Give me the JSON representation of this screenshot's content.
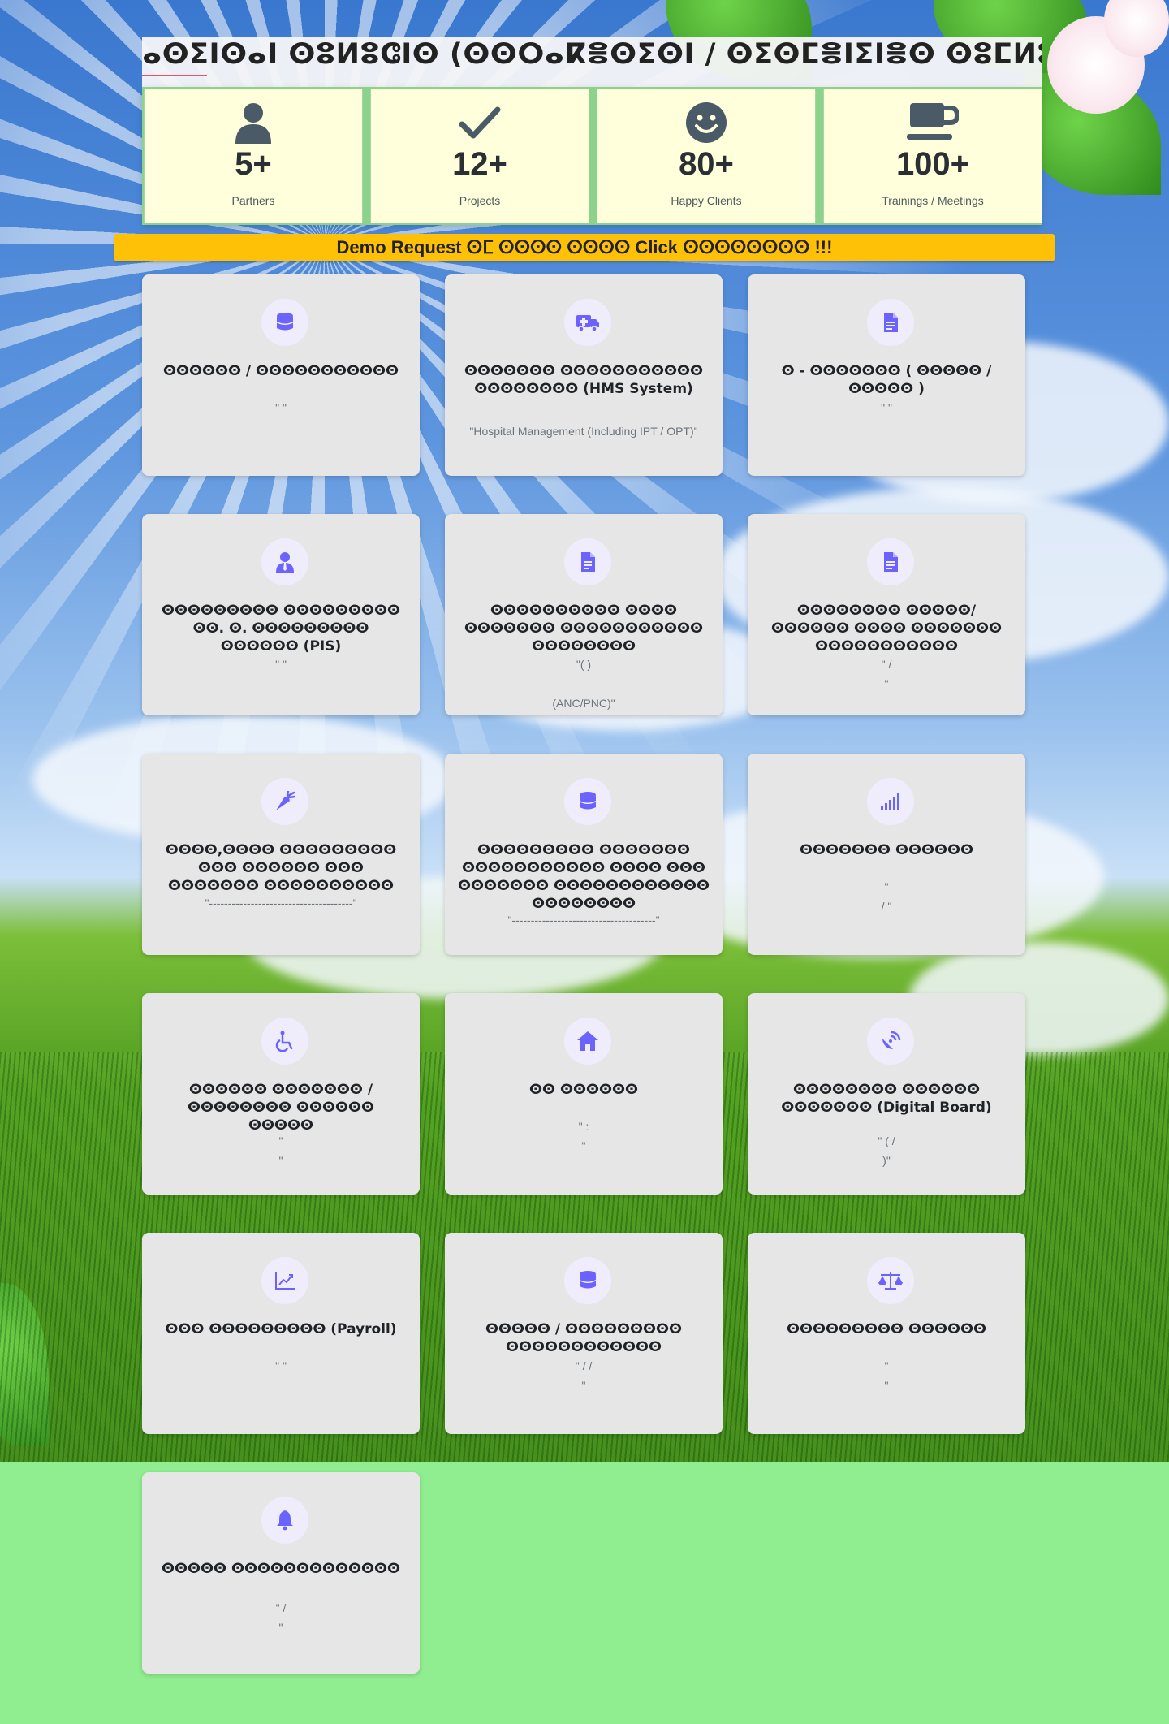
{
  "page": {
    "title": "ⴰⵙⵉⵏⵙⴰⵏ ⵙⵓⵍⵓⵛⵏⵙ (ⵙⵙⵔⴰⴽⴻⵙⵉⵙⵏ / ⵙⵉⵙⵎⴻⵏⵉⵏⴻⵙ ⵙⵓⵎⵍⵓⵙ ⵙⴻⵏⵏⵓⵙⵎⵙⵓⵙⵏ)",
    "demo_request": "Demo Request ⵙⵎ ⵙⵙⵙⵙ ⵙⵙⵙⵙ Click ⵙⵙⵙⵙⵙⵙⵙⵙ !!!"
  },
  "stats": [
    {
      "icon": "user-icon",
      "value": "5+",
      "label": "Partners"
    },
    {
      "icon": "check-icon",
      "value": "12+",
      "label": "Projects"
    },
    {
      "icon": "smile-icon",
      "value": "80+",
      "label": "Happy Clients"
    },
    {
      "icon": "coffee-cup-icon",
      "value": "100+",
      "label": "Trainings / Meetings"
    }
  ],
  "services": [
    {
      "icon": "database-icon",
      "title": "ⵙⵙⵙⵙⵙⵙ / ⵙⵙⵙⵙⵙⵙⵙⵙⵙⵙⵙ",
      "desc": [
        "\"                                                                      \""
      ]
    },
    {
      "icon": "ambulance-icon",
      "title": "ⵙⵙⵙⵙⵙⵙⵙ ⵙⵙⵙⵙⵙⵙⵙⵙⵙⵙⵙ ⵙⵙⵙⵙⵙⵙⵙⵙ (HMS System)",
      "desc": [
        "\"Hospital Management (Including IPT / OPT)\""
      ]
    },
    {
      "icon": "document-icon",
      "title": "ⵙ - ⵙⵙⵙⵙⵙⵙⵙ ( ⵙⵙⵙⵙⵙ / ⵙⵙⵙⵙⵙ )",
      "desc": [
        "\"                                                                      \""
      ]
    },
    {
      "icon": "user-tie-icon",
      "title": "ⵙⵙⵙⵙⵙⵙⵙⵙⵙ ⵙⵙⵙⵙⵙⵙⵙⵙⵙ ⵙⵙ. ⵙ. ⵙⵙⵙⵙⵙⵙⵙⵙⵙ ⵙⵙⵙⵙⵙⵙ (PIS)",
      "desc": [
        "\"                                                              \""
      ]
    },
    {
      "icon": "document-icon",
      "title": "ⵙⵙⵙⵙⵙⵙⵙⵙⵙⵙ ⵙⵙⵙⵙ ⵙⵙⵙⵙⵙⵙⵙ ⵙⵙⵙⵙⵙⵙⵙⵙⵙⵙⵙ ⵙⵙⵙⵙⵙⵙⵙⵙ",
      "desc": [
        "\"(         )",
        "",
        "(ANC/PNC)\""
      ]
    },
    {
      "icon": "document-icon",
      "title": "ⵙⵙⵙⵙⵙⵙⵙⵙ ⵙⵙⵙⵙⵙ/ⵙⵙⵙⵙⵙⵙ ⵙⵙⵙⵙ ⵙⵙⵙⵙⵙⵙⵙ ⵙⵙⵙⵙⵙⵙⵙⵙⵙⵙⵙ",
      "desc": [
        "\"         /",
        "\""
      ]
    },
    {
      "icon": "carrot-icon",
      "title": "ⵙⵙⵙⵙ,ⵙⵙⵙⵙ ⵙⵙⵙⵙⵙⵙⵙⵙⵙ ⵙⵙⵙ ⵙⵙⵙⵙⵙⵙ ⵙⵙⵙ ⵙⵙⵙⵙⵙⵙⵙ ⵙⵙⵙⵙⵙⵙⵙⵙⵙⵙ",
      "desc": [
        "\"--------------------------------------\""
      ]
    },
    {
      "icon": "database-icon",
      "title": "ⵙⵙⵙⵙⵙⵙⵙⵙⵙ ⵙⵙⵙⵙⵙⵙⵙ ⵙⵙⵙⵙⵙⵙⵙⵙⵙⵙⵙ ⵙⵙⵙⵙ ⵙⵙⵙ ⵙⵙⵙⵙⵙⵙⵙ ⵙⵙⵙⵙⵙⵙⵙⵙⵙⵙⵙⵙ ⵙⵙⵙⵙⵙⵙⵙⵙ",
      "desc": [
        "\"--------------------------------------\""
      ]
    },
    {
      "icon": "signal-bars-icon",
      "title": "ⵙⵙⵙⵙⵙⵙⵙ ⵙⵙⵙⵙⵙⵙ",
      "desc": [
        "\"",
        "/                                      \""
      ]
    },
    {
      "icon": "wheelchair-icon",
      "title": "ⵙⵙⵙⵙⵙⵙ ⵙⵙⵙⵙⵙⵙⵙ / ⵙⵙⵙⵙⵙⵙⵙⵙ ⵙⵙⵙⵙⵙⵙ ⵙⵙⵙⵙⵙ",
      "desc": [
        "\"",
        "\""
      ]
    },
    {
      "icon": "home-icon",
      "title": "ⵙⵙ ⵙⵙⵙⵙⵙⵙ",
      "desc": [
        "\"                       :",
        "\""
      ]
    },
    {
      "icon": "satellite-dish-icon",
      "title": "ⵙⵙⵙⵙⵙⵙⵙⵙ ⵙⵙⵙⵙⵙⵙ ⵙⵙⵙⵙⵙⵙⵙ (Digital Board)",
      "desc": [
        "\"                    (                     /",
        ")\""
      ]
    },
    {
      "icon": "chart-line-icon",
      "title": "ⵙⵙⵙ ⵙⵙⵙⵙⵙⵙⵙⵙⵙ (Payroll)",
      "desc": [
        "\"                              \""
      ]
    },
    {
      "icon": "database-icon",
      "title": "ⵙⵙⵙⵙⵙ / ⵙⵙⵙⵙⵙⵙⵙⵙⵙ ⵙⵙⵙⵙⵙⵙⵙⵙⵙⵙⵙⵙ",
      "desc": [
        "\"              /            /",
        "\""
      ]
    },
    {
      "icon": "scale-balance-icon",
      "title": "ⵙⵙⵙⵙⵙⵙⵙⵙⵙ ⵙⵙⵙⵙⵙⵙ",
      "desc": [
        "\"",
        "\""
      ]
    },
    {
      "icon": "bell-icon",
      "title": "ⵙⵙⵙⵙⵙ ⵙⵙⵙⵙⵙⵙⵙⵙⵙⵙⵙⵙⵙ",
      "desc": [
        "\"                    /",
        "\""
      ]
    }
  ],
  "colors": {
    "accent": "#6c63ff",
    "demo_bar": "#ffc107",
    "card_bg": "#e6e6e6",
    "stat_bg": "#ffffdb",
    "footer_bg": "#90ee90"
  }
}
